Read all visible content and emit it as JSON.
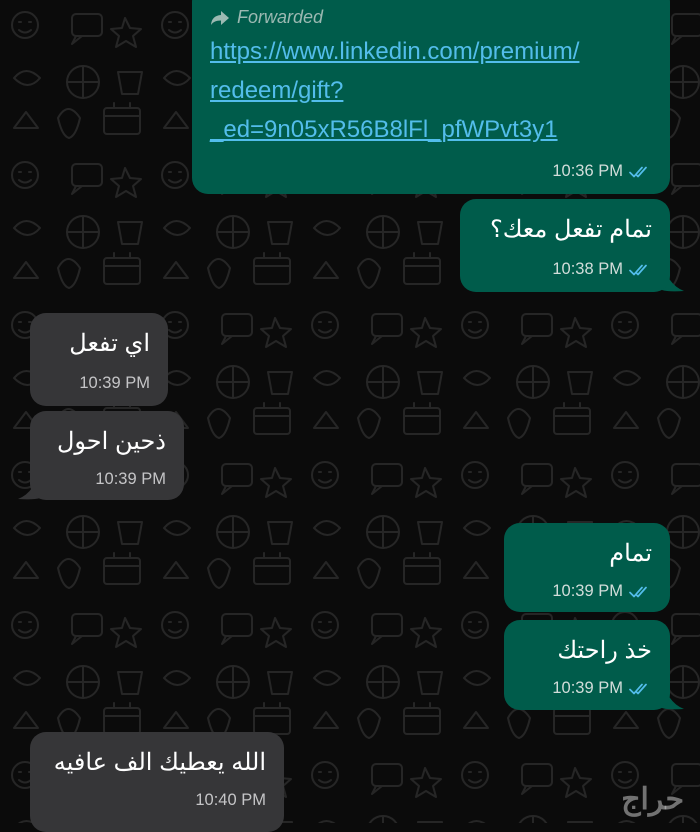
{
  "forwarded_msg": {
    "label": "Forwarded",
    "link_lines": [
      "https://www.linkedin.com/premium/",
      "redeem/gift?",
      "_ed=9n05xR56B8lFl_pfWPvt3y1"
    ],
    "time": "10:36 PM",
    "status": "read"
  },
  "messages": [
    {
      "direction": "out",
      "text": "تمام تفعل معك؟",
      "time": "10:38 PM",
      "status": "read"
    },
    {
      "direction": "in",
      "text": "اي تفعل",
      "time": "10:39 PM"
    },
    {
      "direction": "in",
      "text": "ذحين احول",
      "time": "10:39 PM"
    },
    {
      "direction": "out",
      "text": "تمام",
      "time": "10:39 PM",
      "status": "read"
    },
    {
      "direction": "out",
      "text": "خذ راحتك",
      "time": "10:39 PM",
      "status": "read"
    },
    {
      "direction": "in",
      "text": "الله يعطيك الف عافيه",
      "time": "10:40 PM"
    }
  ],
  "watermark": "حراج",
  "colors": {
    "outgoing_bubble": "#005c4b",
    "incoming_bubble": "#363638",
    "link": "#53bdeb",
    "read_ticks": "#53bdeb",
    "background": "#0b0b0b"
  },
  "icons": {
    "forward": "forward-arrow-icon",
    "read_receipt": "double-check-icon"
  }
}
